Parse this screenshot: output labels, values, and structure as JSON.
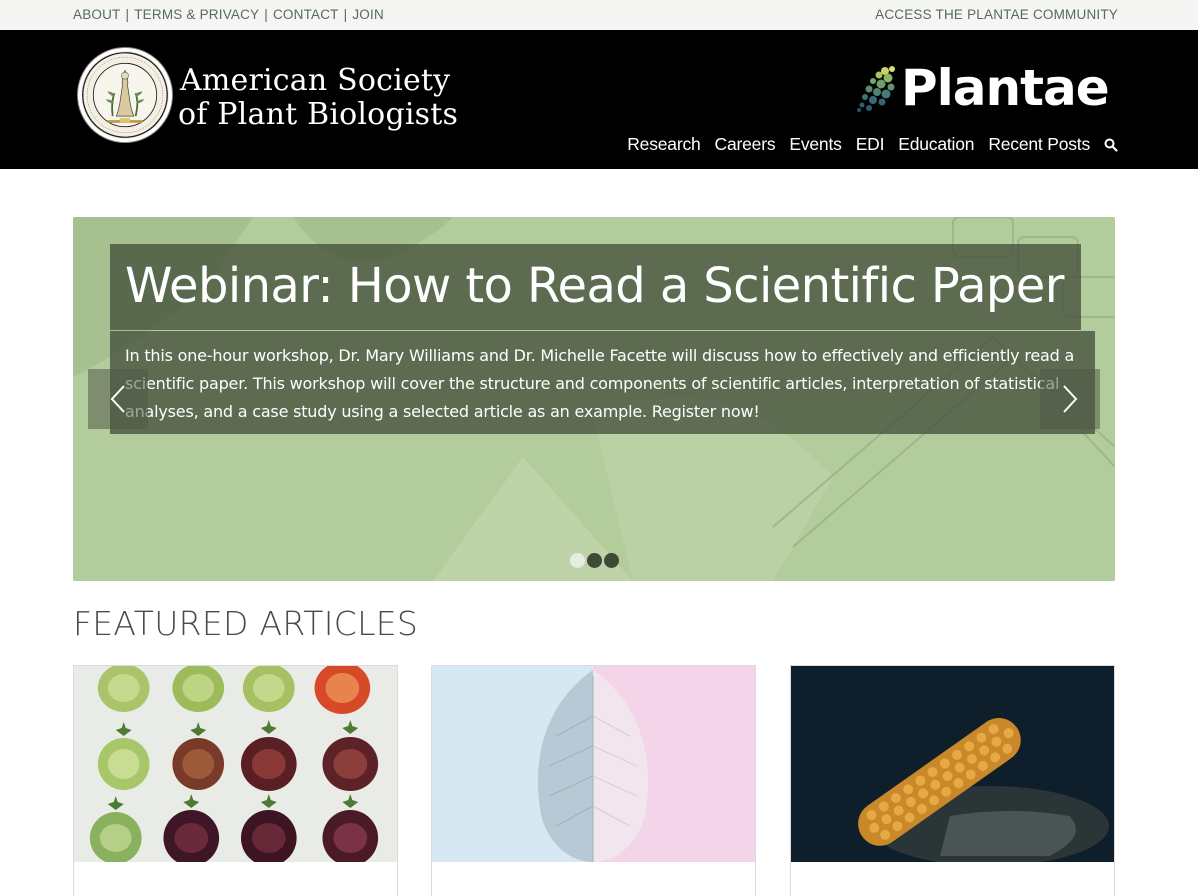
{
  "utility": {
    "links": [
      "ABOUT",
      "TERMS & PRIVACY",
      "CONTACT",
      "JOIN"
    ],
    "separator": "|",
    "community_link": "ACCESS THE PLANTAE COMMUNITY"
  },
  "header": {
    "society_line1": "American Society",
    "society_line2": "of Plant Biologists",
    "plantae_logo": "Plantae",
    "nav": [
      "Research",
      "Careers",
      "Events",
      "EDI",
      "Education",
      "Recent Posts"
    ],
    "search_icon": "search-icon"
  },
  "hero": {
    "title": "Webinar: How to Read a Scientific Paper",
    "description": "In this one-hour workshop, Dr. Mary Williams and Dr. Michelle Facette will discuss how to effectively and efficiently read a scientific paper. This workshop will cover the structure and components of scientific articles, interpretation of statistical analyses, and a case study using a selected article as an example. Register now!",
    "slide_count": 3,
    "active_slide": 1,
    "prev_icon": "chevron-left-icon",
    "next_icon": "chevron-right-icon"
  },
  "featured": {
    "heading": "FEATURED ARTICLES",
    "cards": [
      {
        "image": "tomato-slices-image"
      },
      {
        "image": "leaf-two-tone-image"
      },
      {
        "image": "corn-cob-image"
      }
    ]
  },
  "colors": {
    "header_bg": "#000000",
    "utility_bg": "#f5f5f3",
    "utility_text": "#566a5f",
    "hero_bg": "#b3cc9c",
    "hero_overlay": "#3c4634"
  }
}
